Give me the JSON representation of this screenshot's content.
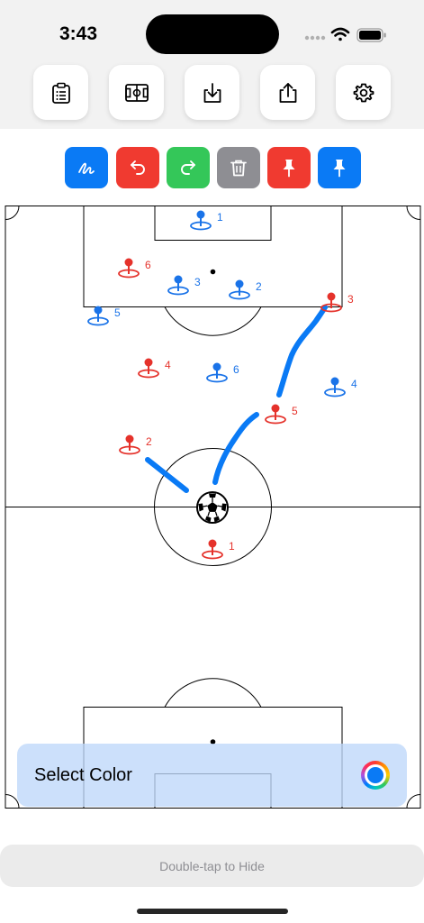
{
  "status_bar": {
    "time": "3:43"
  },
  "toolbar": {
    "buttons": [
      {
        "name": "clipboard"
      },
      {
        "name": "field-view"
      },
      {
        "name": "download"
      },
      {
        "name": "share"
      },
      {
        "name": "settings"
      }
    ]
  },
  "actions": {
    "colors": {
      "draw": "#0a7af5",
      "undo": "#f03a30",
      "redo": "#34c759",
      "delete": "#8e8e93",
      "pin_red": "#f03a30",
      "pin_blue": "#0a7af5"
    }
  },
  "players": {
    "red": [
      "1",
      "2",
      "3",
      "4",
      "5",
      "6"
    ],
    "blue": [
      "1",
      "2",
      "3",
      "4",
      "5",
      "6"
    ],
    "red_color": "#e5322b",
    "blue_color": "#1a73e8"
  },
  "color_panel": {
    "label": "Select Color",
    "selected_color": "#0a7af5"
  },
  "hide_bar": {
    "label": "Double-tap to Hide"
  }
}
